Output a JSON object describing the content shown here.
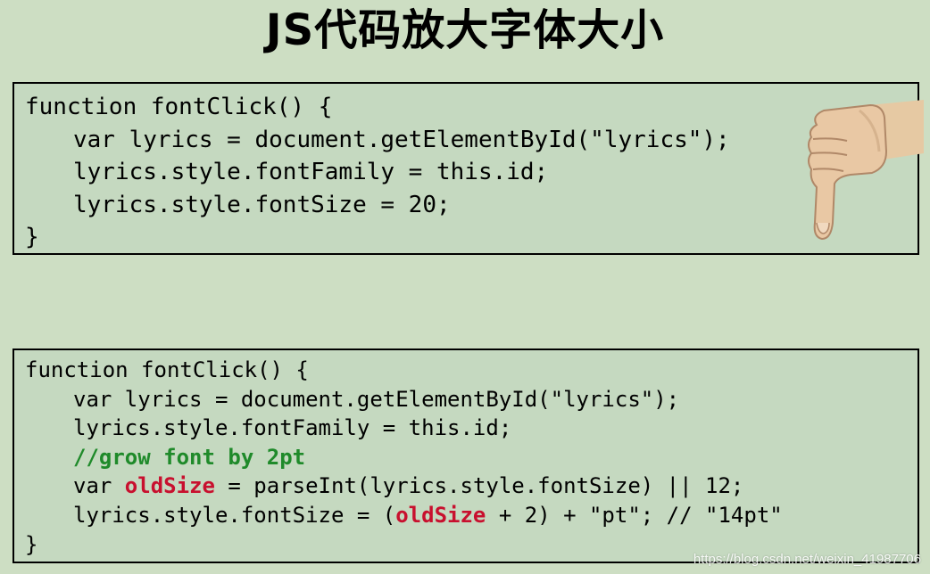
{
  "slide": {
    "title": "JS代码放大字体大小"
  },
  "code_before": {
    "lines": [
      "function fontClick() {",
      "var lyrics = document.getElementById(\"lyrics\");",
      "lyrics.style.fontFamily = this.id;",
      "lyrics.style.fontSize = 20;",
      "}"
    ]
  },
  "code_after": {
    "line1": "function fontClick() {",
    "line2": "var lyrics = document.getElementById(\"lyrics\");",
    "line3": "lyrics.style.fontFamily = this.id;",
    "comment": "//grow font by 2pt",
    "line5_prefix": "var ",
    "line5_var": "oldSize",
    "line5_suffix": " = parseInt(lyrics.style.fontSize) || 12;",
    "line6_prefix": "lyrics.style.fontSize = (",
    "line6_var": "oldSize",
    "line6_suffix": " + 2) + \"pt\"; // \"14pt\"",
    "line7": "}"
  },
  "colors": {
    "background": "#cddec3",
    "code_box": "#c5d9c0",
    "comment": "#1f8a2a",
    "highlight": "#c8102e"
  },
  "icons": {
    "thumb": "thumbs-down-icon"
  },
  "watermark": "https://blog.csdn.net/weixin_41987706"
}
